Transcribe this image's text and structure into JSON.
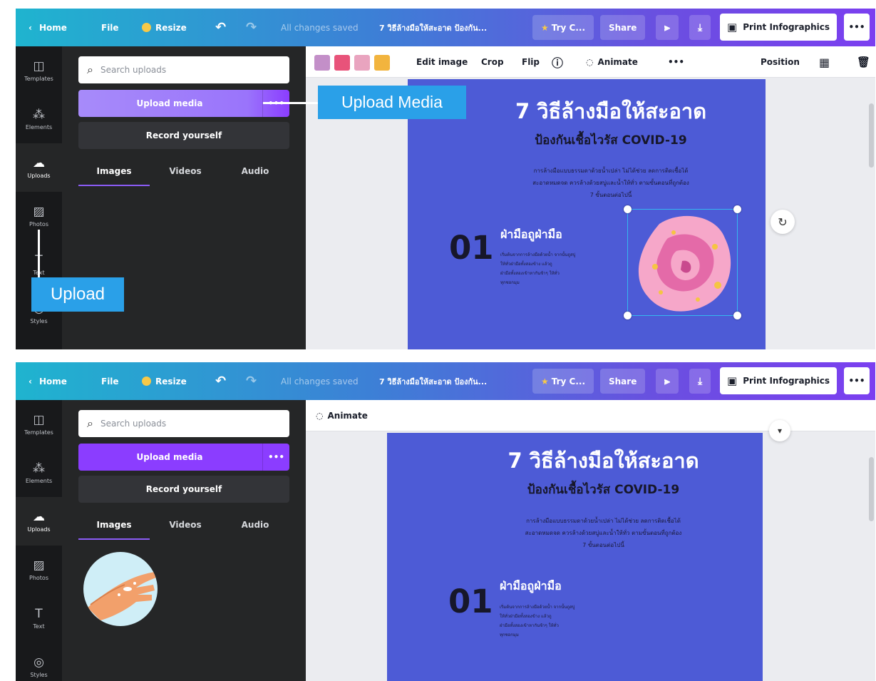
{
  "topbar": {
    "home": "Home",
    "file": "File",
    "resize": "Resize",
    "undo_icon": "undo-icon",
    "redo_icon": "redo-icon",
    "saved_status": "All changes saved",
    "doc_title": "7 วิธีล้างมือให้สะอาด ป้องกัน...",
    "try_label": "Try C...",
    "share": "Share",
    "print_label": "Print Infographics",
    "more": "•••"
  },
  "rail": {
    "items": [
      {
        "label": "Templates",
        "icon": "templates-icon"
      },
      {
        "label": "Elements",
        "icon": "elements-icon"
      },
      {
        "label": "Uploads",
        "icon": "uploads-icon"
      },
      {
        "label": "Photos",
        "icon": "photos-icon"
      },
      {
        "label": "Text",
        "icon": "text-icon"
      },
      {
        "label": "Styles",
        "icon": "styles-icon"
      }
    ]
  },
  "panel": {
    "search_placeholder": "Search uploads",
    "upload_button": "Upload media",
    "upload_more": "•••",
    "record_button": "Record yourself",
    "tabs": [
      "Images",
      "Videos",
      "Audio"
    ]
  },
  "toolbar": {
    "swatch_colors": [
      "#c38fc8",
      "#e8537a",
      "#e9a4bf",
      "#f2b43e"
    ],
    "edit_image": "Edit image",
    "crop": "Crop",
    "flip": "Flip",
    "info_icon": "info-icon",
    "animate": "Animate",
    "more": "•••",
    "position": "Position"
  },
  "design": {
    "title": "7 วิธีล้างมือให้สะอาด",
    "subtitle": "ป้องกันเชื้อไวรัส COVID-19",
    "desc_lines": [
      "การล้างมือแบบธรรมดาด้วยน้ำเปล่า ไม่ได้ช่วย ลดการติดเชื้อได้",
      "สะอาดหมดจด ควรล้างด้วยสบู่และน้ำให้ทั่ว ตามขั้นตอนที่ถูกต้อง",
      "7 ขั้นตอนต่อไปนี้"
    ],
    "step_number": "01",
    "step_title": "ฝ่ามือถูฝ่ามือ",
    "step_lines": [
      "เริ่มต้นจากการล้างมือด้วยน้ำ จากนั้นถูสบู่",
      "ให้ทั่วฝ่ามือทั้งสองข้าง แล้วถู",
      "ฝ่ามือทั้งสองเข้าหากันช้าๆ ให้ทั่ว",
      "ทุกซอกมุม"
    ]
  },
  "annotations": {
    "upload_media": "Upload Media",
    "upload": "Upload"
  },
  "colors": {
    "topbar_start": "#1fb4cf",
    "topbar_end": "#7b3ff0",
    "accent_purple": "#8b3dff",
    "design_bg": "#4d5bd6",
    "callout": "#2aa0e8"
  }
}
